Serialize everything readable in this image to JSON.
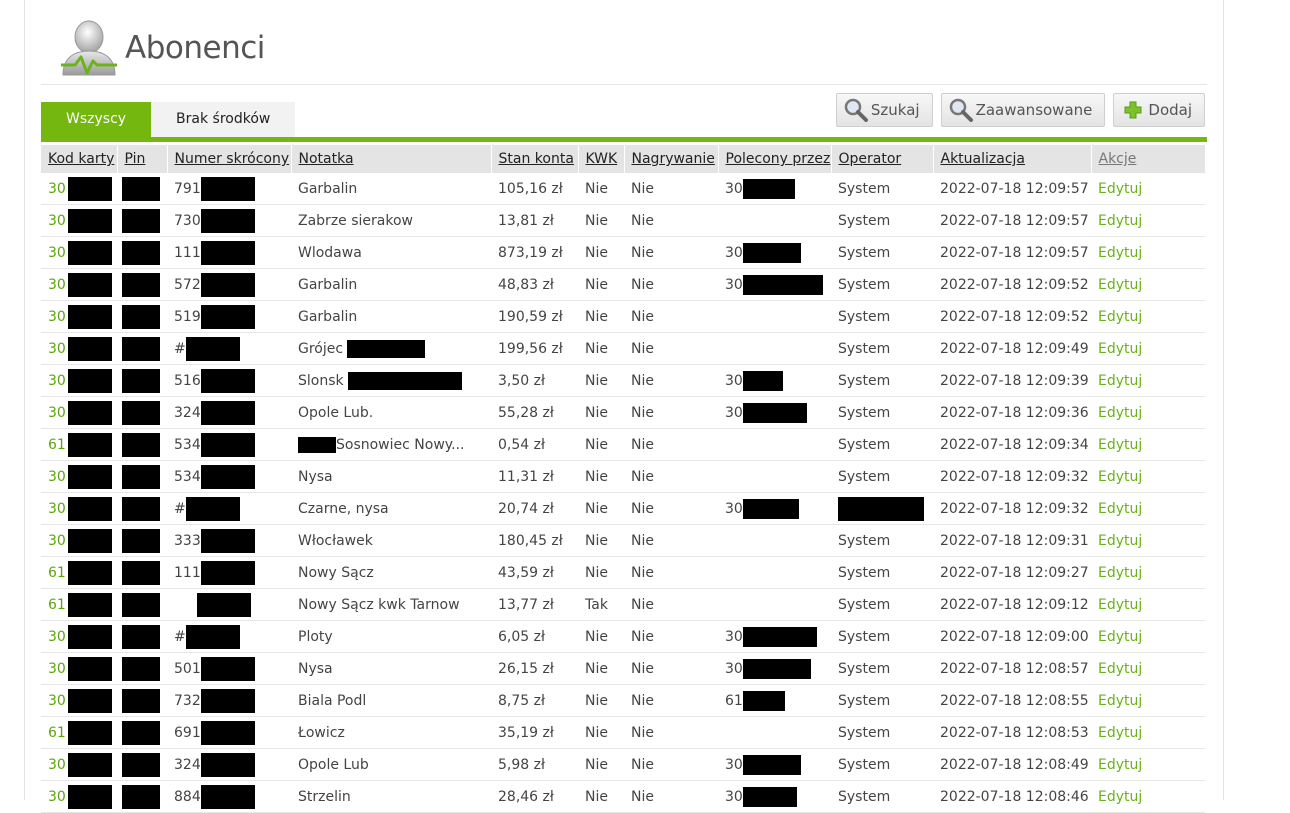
{
  "page": {
    "title": "Abonenci"
  },
  "tabs": [
    {
      "label": "Wszyscy",
      "active": true
    },
    {
      "label": "Brak środków",
      "active": false
    }
  ],
  "toolbar": {
    "search_label": "Szukaj",
    "advanced_label": "Zaawansowane",
    "add_label": "Dodaj"
  },
  "colors": {
    "accent": "#74b70e",
    "link": "#6ab31a"
  },
  "table": {
    "headers": {
      "kod": "Kod karty",
      "pin": "Pin",
      "numer": "Numer skrócony",
      "notatka": "Notatka",
      "stan": "Stan konta",
      "kwk": "KWK",
      "nagr": "Nagrywanie",
      "polecony": "Polecony przez",
      "operator": "Operator",
      "aktualizacja": "Aktualizacja",
      "akcje": "Akcje"
    },
    "rows": [
      {
        "kod": "30",
        "numer": "791",
        "notatka": "Garbalin",
        "stan": "105,16 zł",
        "kwk": "Nie",
        "nagr": "Nie",
        "polecony": "30",
        "operator": "System",
        "akt": "2022-07-18 12:09:57",
        "akcje": "Edytuj"
      },
      {
        "kod": "30",
        "numer": "730",
        "notatka": "Zabrze sierakow",
        "stan": "13,81 zł",
        "kwk": "Nie",
        "nagr": "Nie",
        "polecony": "",
        "operator": "System",
        "akt": "2022-07-18 12:09:57",
        "akcje": "Edytuj"
      },
      {
        "kod": "30",
        "numer": "111",
        "notatka": "Wlodawa",
        "stan": "873,19 zł",
        "kwk": "Nie",
        "nagr": "Nie",
        "polecony": "30",
        "operator": "System",
        "akt": "2022-07-18 12:09:57",
        "akcje": "Edytuj"
      },
      {
        "kod": "30",
        "numer": "572",
        "notatka": "Garbalin",
        "stan": "48,83 zł",
        "kwk": "Nie",
        "nagr": "Nie",
        "polecony": "30",
        "operator": "System",
        "akt": "2022-07-18 12:09:52",
        "akcje": "Edytuj"
      },
      {
        "kod": "30",
        "numer": "519",
        "notatka": "Garbalin",
        "stan": "190,59 zł",
        "kwk": "Nie",
        "nagr": "Nie",
        "polecony": "",
        "operator": "System",
        "akt": "2022-07-18 12:09:52",
        "akcje": "Edytuj"
      },
      {
        "kod": "30",
        "numer": "#",
        "notatka": "Grójec",
        "stan": "199,56 zł",
        "kwk": "Nie",
        "nagr": "Nie",
        "polecony": "",
        "operator": "System",
        "akt": "2022-07-18 12:09:49",
        "akcje": "Edytuj"
      },
      {
        "kod": "30",
        "numer": "516",
        "notatka": "Slonsk",
        "stan": "3,50 zł",
        "kwk": "Nie",
        "nagr": "Nie",
        "polecony": "30",
        "operator": "System",
        "akt": "2022-07-18 12:09:39",
        "akcje": "Edytuj"
      },
      {
        "kod": "30",
        "numer": "324",
        "notatka": "Opole Lub.",
        "stan": "55,28 zł",
        "kwk": "Nie",
        "nagr": "Nie",
        "polecony": "30",
        "operator": "System",
        "akt": "2022-07-18 12:09:36",
        "akcje": "Edytuj"
      },
      {
        "kod": "61",
        "numer": "534",
        "notatka": "Sosnowiec Nowy...",
        "stan": "0,54 zł",
        "kwk": "Nie",
        "nagr": "Nie",
        "polecony": "",
        "operator": "System",
        "akt": "2022-07-18 12:09:34",
        "akcje": "Edytuj"
      },
      {
        "kod": "30",
        "numer": "534",
        "notatka": "Nysa",
        "stan": "11,31 zł",
        "kwk": "Nie",
        "nagr": "Nie",
        "polecony": "",
        "operator": "System",
        "akt": "2022-07-18 12:09:32",
        "akcje": "Edytuj"
      },
      {
        "kod": "30",
        "numer": "#",
        "notatka": "Czarne, nysa",
        "stan": "20,74 zł",
        "kwk": "Nie",
        "nagr": "Nie",
        "polecony": "30",
        "operator": "",
        "akt": "2022-07-18 12:09:32",
        "akcje": "Edytuj"
      },
      {
        "kod": "30",
        "numer": "333",
        "notatka": "Włocławek",
        "stan": "180,45 zł",
        "kwk": "Nie",
        "nagr": "Nie",
        "polecony": "",
        "operator": "System",
        "akt": "2022-07-18 12:09:31",
        "akcje": "Edytuj"
      },
      {
        "kod": "61",
        "numer": "111",
        "notatka": "Nowy Sącz",
        "stan": "43,59 zł",
        "kwk": "Nie",
        "nagr": "Nie",
        "polecony": "",
        "operator": "System",
        "akt": "2022-07-18 12:09:27",
        "akcje": "Edytuj"
      },
      {
        "kod": "61",
        "numer": "",
        "notatka": "Nowy Sącz kwk Tarnow",
        "stan": "13,77 zł",
        "kwk": "Tak",
        "nagr": "Nie",
        "polecony": "",
        "operator": "System",
        "akt": "2022-07-18 12:09:12",
        "akcje": "Edytuj"
      },
      {
        "kod": "30",
        "numer": "#",
        "notatka": "Ploty",
        "stan": "6,05 zł",
        "kwk": "Nie",
        "nagr": "Nie",
        "polecony": "30",
        "operator": "System",
        "akt": "2022-07-18 12:09:00",
        "akcje": "Edytuj"
      },
      {
        "kod": "30",
        "numer": "501",
        "notatka": "Nysa",
        "stan": "26,15 zł",
        "kwk": "Nie",
        "nagr": "Nie",
        "polecony": "30",
        "operator": "System",
        "akt": "2022-07-18 12:08:57",
        "akcje": "Edytuj"
      },
      {
        "kod": "30",
        "numer": "732",
        "notatka": "Biala Podl",
        "stan": "8,75 zł",
        "kwk": "Nie",
        "nagr": "Nie",
        "polecony": "61",
        "operator": "System",
        "akt": "2022-07-18 12:08:55",
        "akcje": "Edytuj"
      },
      {
        "kod": "61",
        "numer": "691",
        "notatka": "Łowicz",
        "stan": "35,19 zł",
        "kwk": "Nie",
        "nagr": "Nie",
        "polecony": "",
        "operator": "System",
        "akt": "2022-07-18 12:08:53",
        "akcje": "Edytuj"
      },
      {
        "kod": "30",
        "numer": "324",
        "notatka": "Opole Lub",
        "stan": "5,98 zł",
        "kwk": "Nie",
        "nagr": "Nie",
        "polecony": "30",
        "operator": "System",
        "akt": "2022-07-18 12:08:49",
        "akcje": "Edytuj"
      },
      {
        "kod": "30",
        "numer": "884",
        "notatka": "Strzelin",
        "stan": "28,46 zł",
        "kwk": "Nie",
        "nagr": "Nie",
        "polecony": "30",
        "operator": "System",
        "akt": "2022-07-18 12:08:46",
        "akcje": "Edytuj"
      }
    ]
  }
}
